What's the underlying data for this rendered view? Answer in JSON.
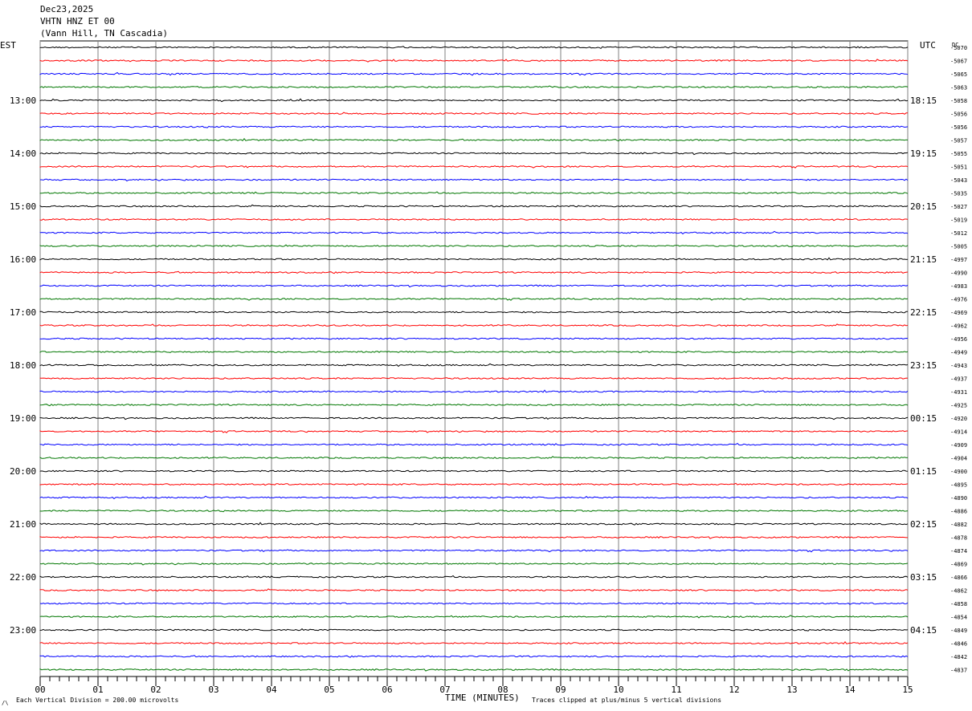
{
  "header": {
    "date": "Dec23,2025",
    "channel": "VHTN HNZ ET 00",
    "station": "(Vann Hill, TN Cascadia)"
  },
  "left_zone": "EST",
  "right_zone": "UTC",
  "dc_label": "DC",
  "footer": {
    "vertical_division": "Each Vertical Division =  200.00 microvolts",
    "clip_note": "Traces clipped at plus/minus 5 vertical divisions",
    "corner_mark": "/\\"
  },
  "colors": {
    "trace_cycle": [
      "#000000",
      "#ff0000",
      "#0000ff",
      "#007700"
    ],
    "grid": "#808080"
  },
  "chart_data": {
    "type": "line",
    "title": "VHTN HNZ ET 00",
    "xlabel": "TIME (MINUTES)",
    "xlim": [
      0,
      15
    ],
    "x_ticks": [
      "00",
      "01",
      "02",
      "03",
      "04",
      "05",
      "06",
      "07",
      "08",
      "09",
      "10",
      "11",
      "12",
      "13",
      "14",
      "15"
    ],
    "trace_count": 48,
    "trace_minutes": 15,
    "est_hour_labels": [
      {
        "trace": 4,
        "label": "13:00"
      },
      {
        "trace": 8,
        "label": "14:00"
      },
      {
        "trace": 12,
        "label": "15:00"
      },
      {
        "trace": 16,
        "label": "16:00"
      },
      {
        "trace": 20,
        "label": "17:00"
      },
      {
        "trace": 24,
        "label": "18:00"
      },
      {
        "trace": 28,
        "label": "19:00"
      },
      {
        "trace": 32,
        "label": "20:00"
      },
      {
        "trace": 36,
        "label": "21:00"
      },
      {
        "trace": 40,
        "label": "22:00"
      },
      {
        "trace": 44,
        "label": "23:00"
      }
    ],
    "utc_hour_labels": [
      {
        "trace": 4,
        "label": "18:15"
      },
      {
        "trace": 8,
        "label": "19:15"
      },
      {
        "trace": 12,
        "label": "20:15"
      },
      {
        "trace": 16,
        "label": "21:15"
      },
      {
        "trace": 20,
        "label": "22:15"
      },
      {
        "trace": 24,
        "label": "23:15"
      },
      {
        "trace": 28,
        "label": "00:15"
      },
      {
        "trace": 32,
        "label": "01:15"
      },
      {
        "trace": 36,
        "label": "02:15"
      },
      {
        "trace": 40,
        "label": "03:15"
      },
      {
        "trace": 44,
        "label": "04:15"
      }
    ],
    "dc_offsets": [
      "-5070",
      "-5067",
      "-5065",
      "-5063",
      "-5058",
      "-5056",
      "-5056",
      "-5057",
      "-5055",
      "-5051",
      "-5043",
      "-5035",
      "-5027",
      "-5019",
      "-5012",
      "-5005",
      "-4997",
      "-4990",
      "-4983",
      "-4976",
      "-4969",
      "-4962",
      "-4956",
      "-4949",
      "-4943",
      "-4937",
      "-4931",
      "-4925",
      "-4920",
      "-4914",
      "-4909",
      "-4904",
      "-4900",
      "-4895",
      "-4890",
      "-4886",
      "-4882",
      "-4878",
      "-4874",
      "-4869",
      "-4866",
      "-4862",
      "-4858",
      "-4854",
      "-4849",
      "-4846",
      "-4842",
      "-4837"
    ]
  }
}
